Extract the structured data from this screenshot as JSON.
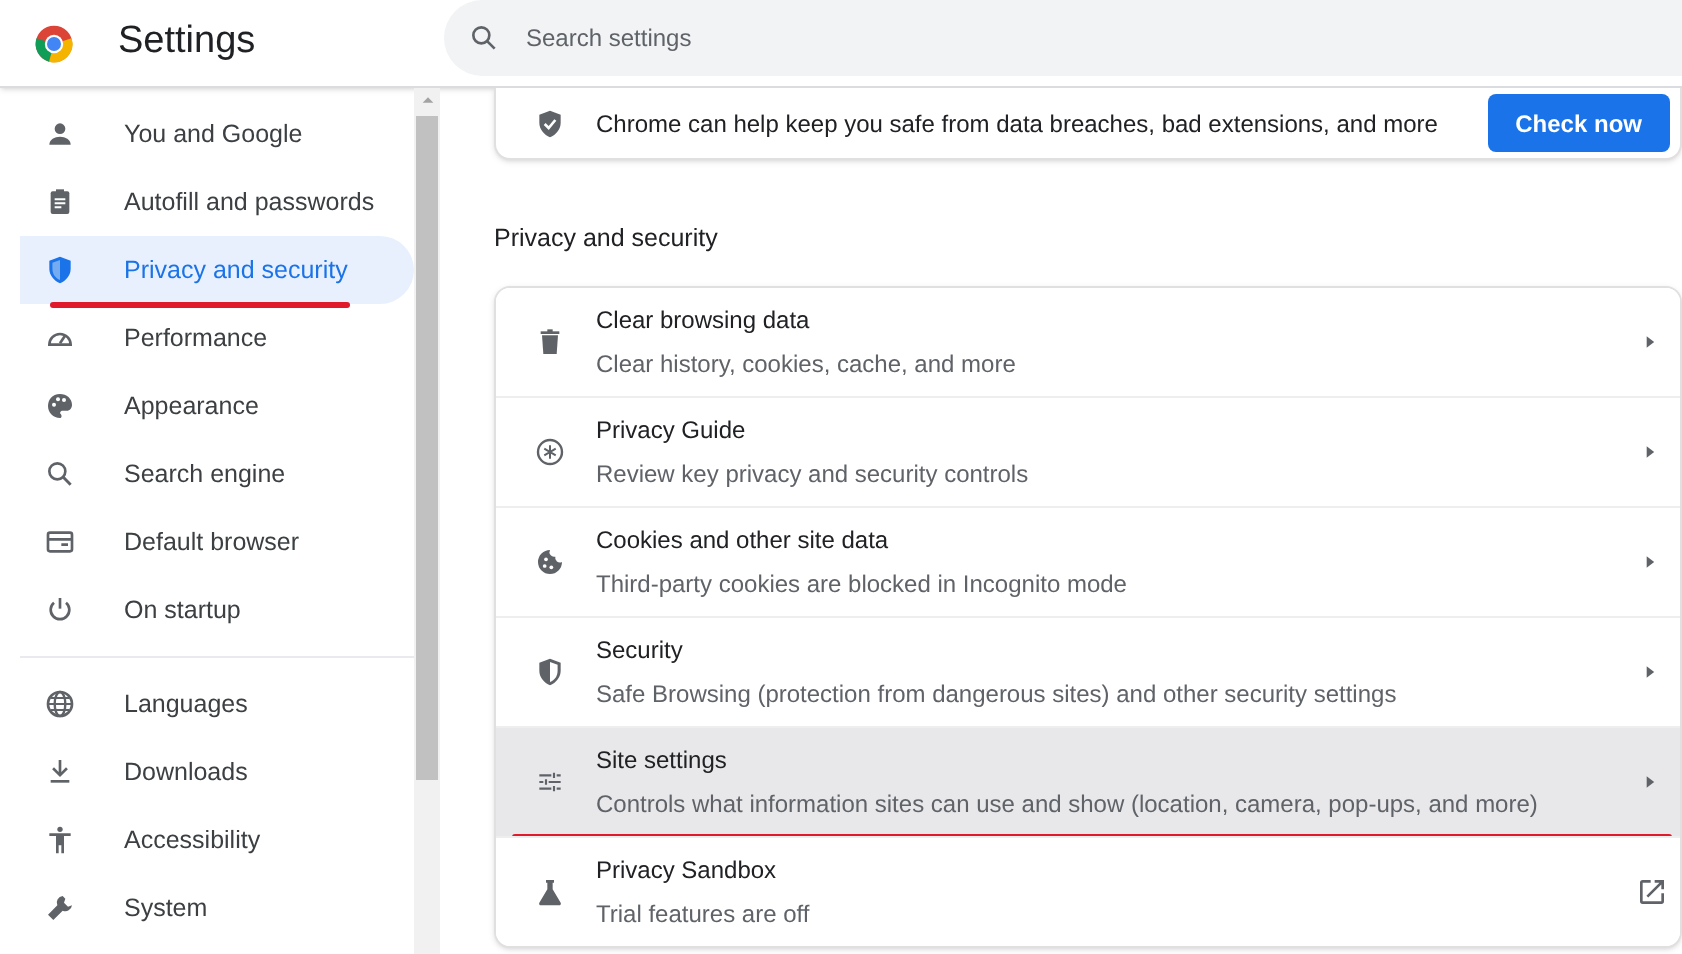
{
  "header": {
    "title": "Settings",
    "search": {
      "placeholder": "Search settings"
    }
  },
  "sidebar": {
    "sections": [
      [
        {
          "label": "You and Google",
          "selected": false,
          "underlined": false
        },
        {
          "label": "Autofill and passwords",
          "selected": false,
          "underlined": false
        },
        {
          "label": "Privacy and security",
          "selected": true,
          "underlined": true
        },
        {
          "label": "Performance",
          "selected": false,
          "underlined": false
        },
        {
          "label": "Appearance",
          "selected": false,
          "underlined": false
        },
        {
          "label": "Search engine",
          "selected": false,
          "underlined": false
        },
        {
          "label": "Default browser",
          "selected": false,
          "underlined": false
        },
        {
          "label": "On startup",
          "selected": false,
          "underlined": false
        }
      ],
      [
        {
          "label": "Languages",
          "selected": false,
          "underlined": false
        },
        {
          "label": "Downloads",
          "selected": false,
          "underlined": false
        },
        {
          "label": "Accessibility",
          "selected": false,
          "underlined": false
        },
        {
          "label": "System",
          "selected": false,
          "underlined": false
        }
      ]
    ]
  },
  "safety_check": {
    "text": "Chrome can help keep you safe from data breaches, bad extensions, and more",
    "button": "Check now"
  },
  "section": {
    "heading": "Privacy and security",
    "rows": [
      {
        "title": "Clear browsing data",
        "subtitle": "Clear history, cookies, cache, and more",
        "kind": "arrow",
        "highlighted": false,
        "underlined": false
      },
      {
        "title": "Privacy Guide",
        "subtitle": "Review key privacy and security controls",
        "kind": "arrow",
        "highlighted": false,
        "underlined": false
      },
      {
        "title": "Cookies and other site data",
        "subtitle": "Third-party cookies are blocked in Incognito mode",
        "kind": "arrow",
        "highlighted": false,
        "underlined": false
      },
      {
        "title": "Security",
        "subtitle": "Safe Browsing (protection from dangerous sites) and other security settings",
        "kind": "arrow",
        "highlighted": false,
        "underlined": false
      },
      {
        "title": "Site settings",
        "subtitle": "Controls what information sites can use and show (location, camera, pop-ups, and more)",
        "kind": "arrow",
        "highlighted": true,
        "underlined": true
      },
      {
        "title": "Privacy Sandbox",
        "subtitle": "Trial features are off",
        "kind": "external",
        "highlighted": false,
        "underlined": false
      }
    ]
  }
}
